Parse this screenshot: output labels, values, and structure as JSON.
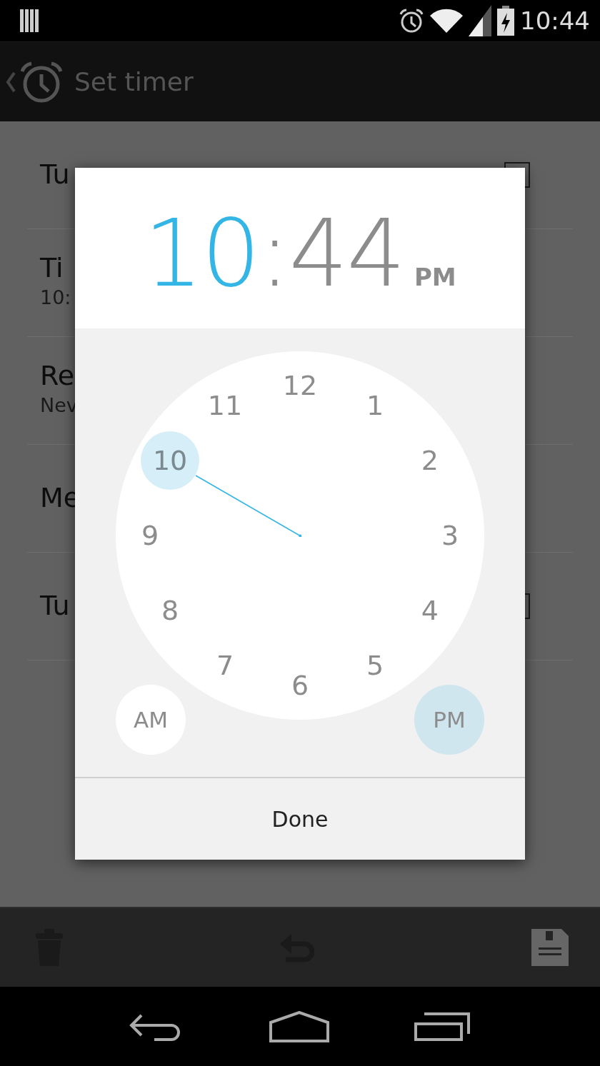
{
  "status_bar": {
    "time": "10:44"
  },
  "action_bar": {
    "title": "Set timer"
  },
  "settings_rows": [
    {
      "kind": "checkbox",
      "title": "Tu",
      "checked": false
    },
    {
      "kind": "text",
      "title": "Ti",
      "subtitle": "10:"
    },
    {
      "kind": "text",
      "title": "Re",
      "subtitle": "Nev"
    },
    {
      "kind": "text",
      "title": "Me"
    },
    {
      "kind": "checkbox",
      "title": "Tu",
      "checked": false
    }
  ],
  "time_picker": {
    "hours": "10",
    "separator": ":",
    "minutes": "44",
    "ampm": "PM",
    "hours_selected": true,
    "dial": [
      {
        "label": "12",
        "selected": false
      },
      {
        "label": "1",
        "selected": false
      },
      {
        "label": "2",
        "selected": false
      },
      {
        "label": "3",
        "selected": false
      },
      {
        "label": "4",
        "selected": false
      },
      {
        "label": "5",
        "selected": false
      },
      {
        "label": "6",
        "selected": false
      },
      {
        "label": "7",
        "selected": false
      },
      {
        "label": "8",
        "selected": false
      },
      {
        "label": "9",
        "selected": false
      },
      {
        "label": "10",
        "selected": true
      },
      {
        "label": "11",
        "selected": false
      }
    ],
    "am_pm_buttons": [
      {
        "label": "AM",
        "selected": false
      },
      {
        "label": "PM",
        "selected": true
      }
    ],
    "done_button": "Done"
  }
}
